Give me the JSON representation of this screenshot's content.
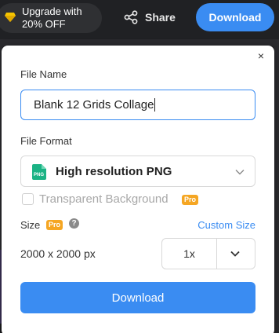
{
  "header": {
    "upgrade_line1": "Upgrade with",
    "upgrade_line2": "20% OFF",
    "share_label": "Share",
    "download_label": "Download"
  },
  "panel": {
    "close_glyph": "×",
    "file_name_label": "File Name",
    "file_name_value": "Blank 12 Grids Collage",
    "file_format_label": "File Format",
    "format_icon_text": "PNG",
    "format_selected": "High resolution PNG",
    "transparent_label": "Transparent Background",
    "pro_badge": "Pro",
    "size_label": "Size",
    "help_glyph": "?",
    "custom_size_label": "Custom Size",
    "dimensions": "2000 x 2000 px",
    "scale_value": "1x",
    "download_label": "Download"
  },
  "colors": {
    "accent": "#3a8cf2",
    "pro": "#f5a623",
    "topbar": "#202124"
  },
  "icons": [
    "diamond-icon",
    "share-icon",
    "close-icon",
    "png-file-icon",
    "chevron-down-icon",
    "help-icon"
  ]
}
